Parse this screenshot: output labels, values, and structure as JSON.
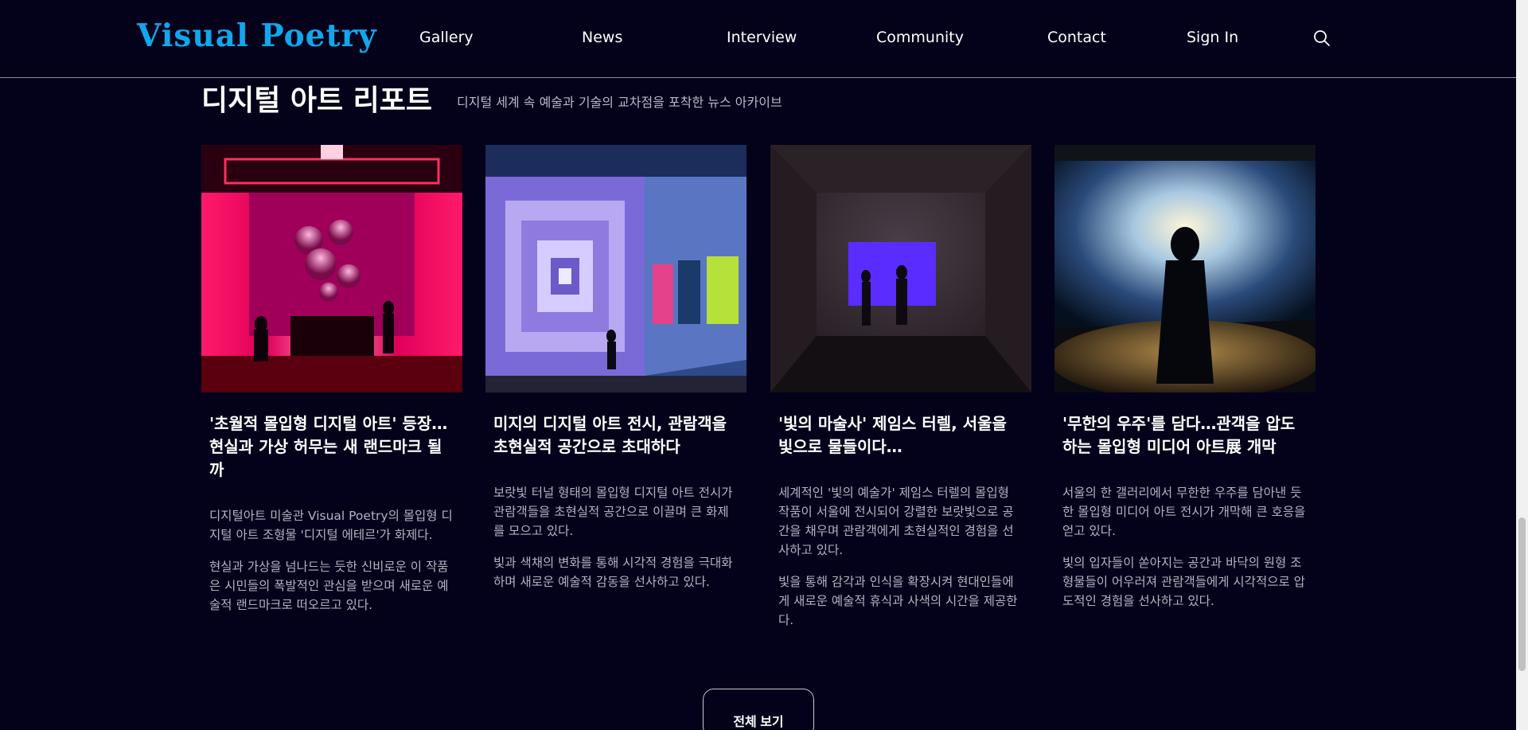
{
  "header": {
    "logo": "Visual Poetry",
    "nav": [
      "Gallery",
      "News",
      "Interview",
      "Community",
      "Contact",
      "Sign In"
    ]
  },
  "icons": {
    "search": "search-icon"
  },
  "section": {
    "title": "디지털 아트 리포트",
    "subtitle": "디지털 세계 속 예술과 기술의 교차점을 포착한 뉴스 아카이브"
  },
  "articles": [
    {
      "title": "'초월적 몰입형 디지털 아트' 등장… 현실과 가상 허무는 새 랜드마크 될까",
      "p1": "디지털아트 미술관 Visual Poetry의 몰입형 디지털 아트 조형물 '디지털 에테르'가 화제다.",
      "p2": "현실과 가상을 넘나드는 듯한 신비로운 이 작품은 시민들의 폭발적인 관심을 받으며 새로운 예술적 랜드마크로 떠오르고 있다."
    },
    {
      "title": "미지의 디지털 아트 전시, 관람객을 초현실적 공간으로 초대하다",
      "p1": "보랏빛 터널 형태의 몰입형 디지털 아트 전시가 관람객들을 초현실적 공간으로 이끌며 큰 화제를 모으고 있다.",
      "p2": "빛과 색채의 변화를 통해 시각적 경험을 극대화하며 새로운 예술적 감동을 선사하고 있다."
    },
    {
      "title": "'빛의 마술사' 제임스 터렐, 서울을 빛으로 물들이다…",
      "p1": "세계적인 '빛의 예술가' 제임스 터렐의 몰입형 작품이 서울에 전시되어 강렬한 보랏빛으로 공간을 채우며 관람객에게 초현실적인 경험을 선사하고 있다.",
      "p2": "빛을 통해 감각과 인식을 확장시켜 현대인들에게 새로운 예술적 휴식과 사색의 시간을 제공한다."
    },
    {
      "title": "'무한의 우주'를 담다…관객을 압도하는 몰입형 미디어 아트展 개막",
      "p1": "서울의 한 갤러리에서 무한한 우주를 담아낸 듯한 몰입형 미디어 아트 전시가 개막해 큰 호응을 얻고 있다.",
      "p2": "빛의 입자들이 쏟아지는 공간과 바닥의 원형 조형물들이 어우러져 관람객들에게 시각적으로 압도적인 경험을 선사하고 있다."
    }
  ],
  "view_all": "전체 보기"
}
